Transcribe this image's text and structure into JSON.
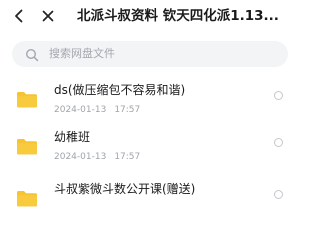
{
  "header": {
    "title": "北派斗叔资料 钦天四化派1.13...",
    "back_icon": "chevron-left-icon",
    "close_icon": "close-icon"
  },
  "search": {
    "placeholder": "搜索网盘文件",
    "icon": "search-icon"
  },
  "files": [
    {
      "name": "ds(做压缩包不容易和谐)",
      "date": "2024-01-13",
      "time": "17:57",
      "icon": "folder-icon"
    },
    {
      "name": "幼稚班",
      "date": "2024-01-13",
      "time": "17:57",
      "icon": "folder-icon"
    },
    {
      "name": "斗叔紫微斗数公开课(赠送)",
      "date": "",
      "time": "",
      "icon": "folder-icon"
    }
  ],
  "colors": {
    "folder": "#F6C431",
    "search_bg": "#F3F4F6",
    "muted_text": "#A0A4AA"
  }
}
